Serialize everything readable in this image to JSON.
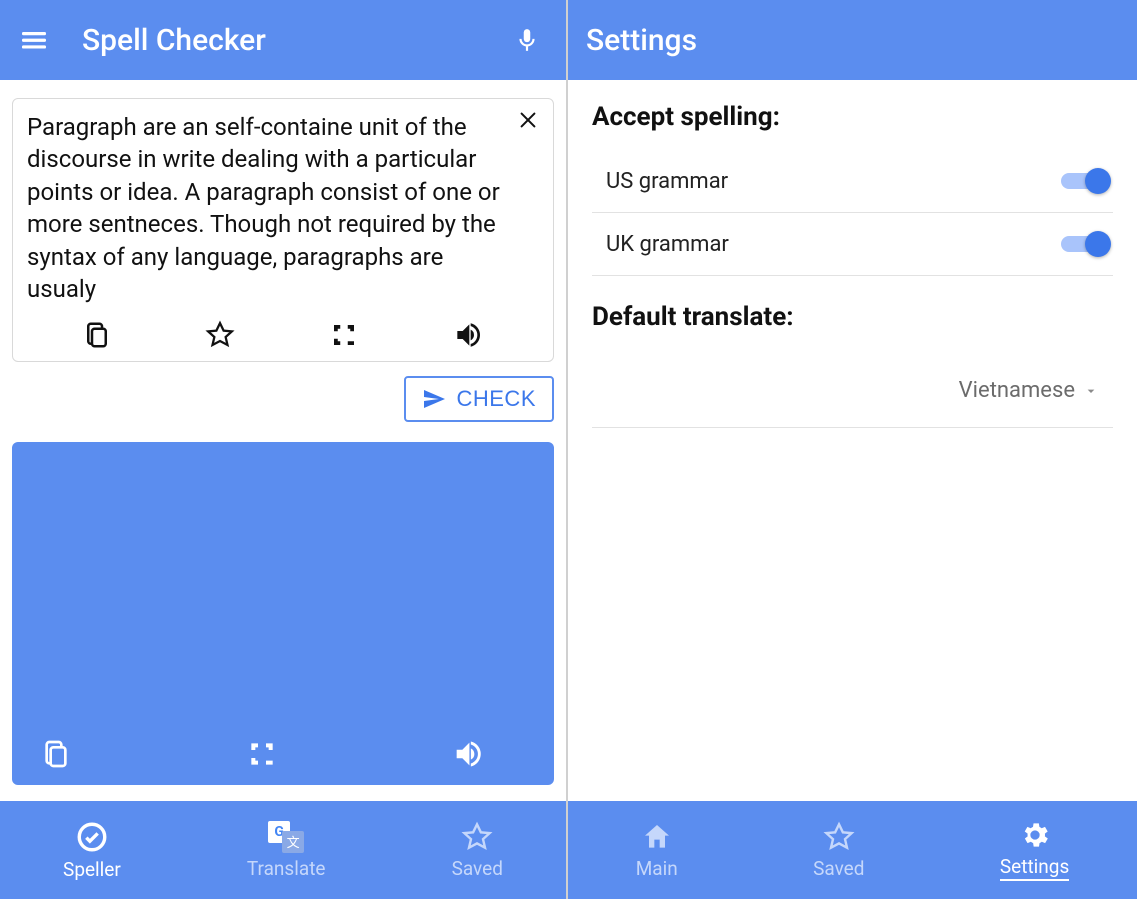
{
  "left": {
    "appbar": {
      "title": "Spell Checker"
    },
    "inputText": "Paragraph are an self-containe unit of the discourse in write dealing with a particular points or idea. A paragraph consist of one or more sentneces. Though not required by the syntax of any language, paragraphs are usualy",
    "checkLabel": "CHECK",
    "nav": {
      "speller": "Speller",
      "translate": "Translate",
      "saved": "Saved"
    }
  },
  "right": {
    "appbar": {
      "title": "Settings"
    },
    "acceptSpellingTitle": "Accept spelling:",
    "usGrammar": "US grammar",
    "ukGrammar": "UK grammar",
    "defaultTranslateTitle": "Default translate:",
    "defaultLanguage": "Vietnamese",
    "nav": {
      "main": "Main",
      "saved": "Saved",
      "settings": "Settings"
    }
  }
}
